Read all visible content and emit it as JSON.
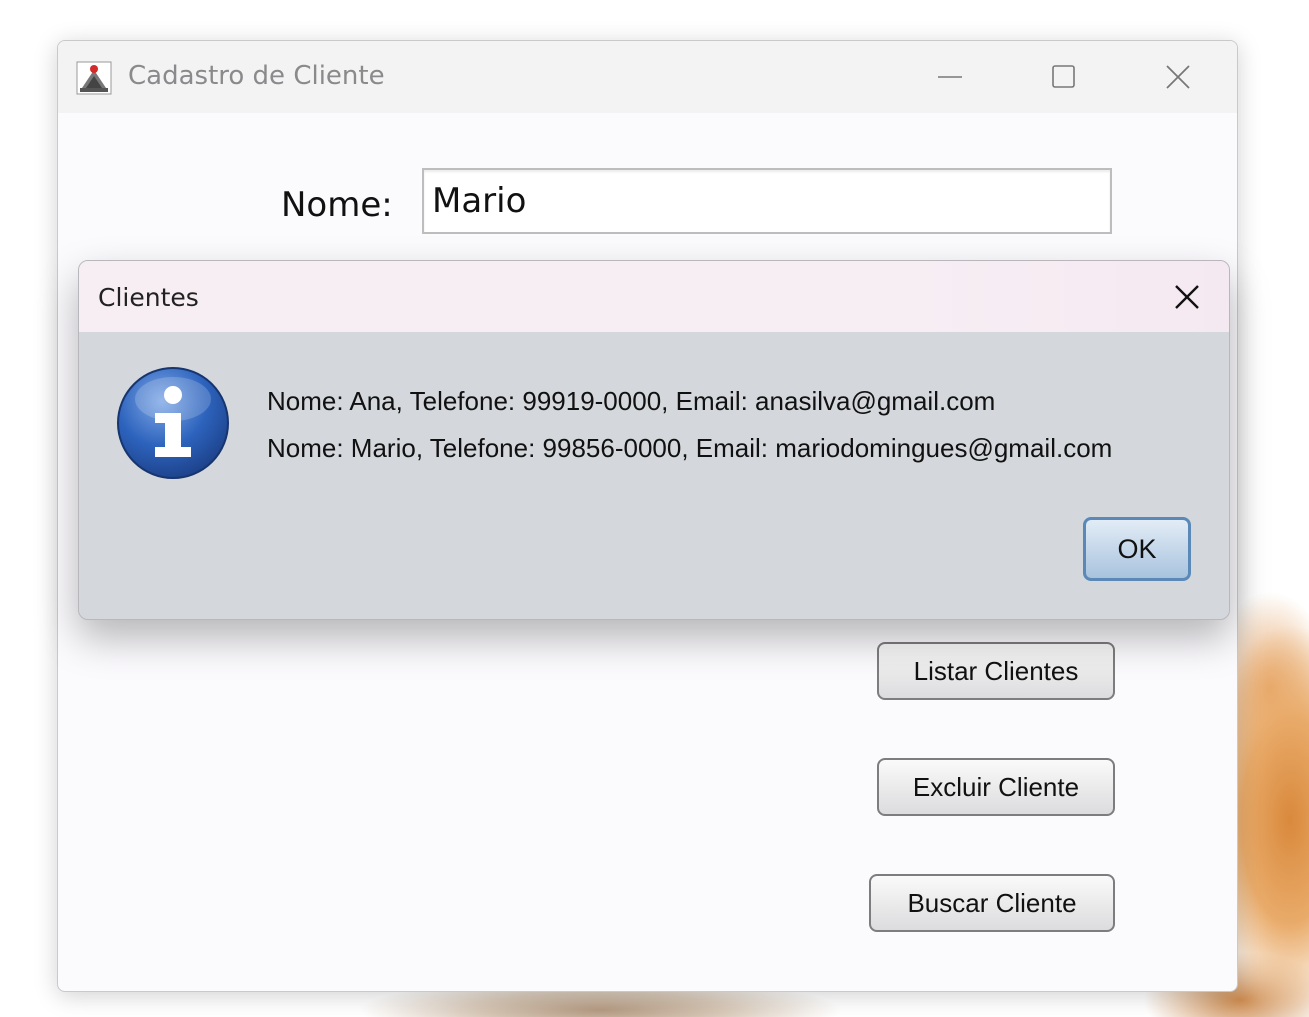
{
  "main_window": {
    "title": "Cadastro de Cliente",
    "app_icon": "java-cup-icon",
    "controls": [
      "minimize-icon",
      "maximize-icon",
      "close-icon"
    ]
  },
  "form": {
    "nome_label": "Nome:",
    "nome_value": "Mario"
  },
  "buttons": {
    "listar": "Listar Clientes",
    "excluir": "Excluir Cliente",
    "buscar": "Buscar Cliente"
  },
  "dialog": {
    "title": "Clientes",
    "icon": "info-icon",
    "lines": [
      "Nome: Ana, Telefone: 99919-0000, Email: anasilva@gmail.com",
      "Nome: Mario, Telefone: 99856-0000, Email: mariodomingues@gmail.com"
    ],
    "ok_label": "OK"
  },
  "colors": {
    "dialog_body": "#d4d8dc",
    "dialog_titlebar": "#f7eef3",
    "ok_border": "#5a89b8",
    "info_icon": "#2a5fb0"
  }
}
